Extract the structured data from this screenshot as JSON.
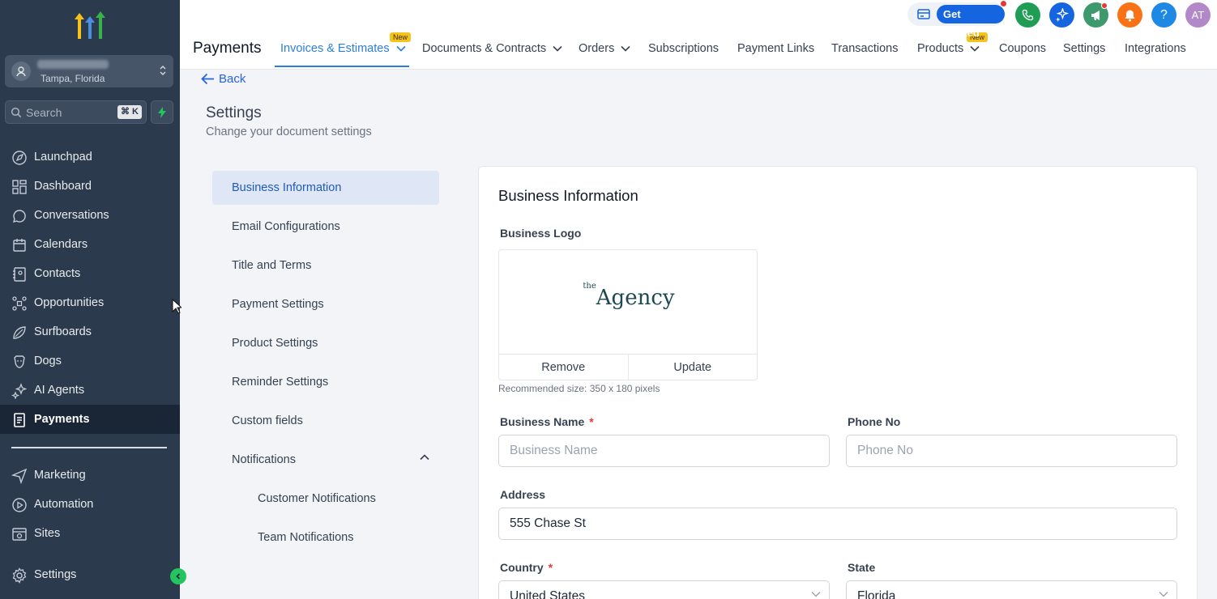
{
  "sidebar": {
    "account_location": "Tampa, Florida",
    "search_placeholder": "Search",
    "search_shortcut": "⌘ K",
    "items": [
      {
        "label": "Launchpad",
        "icon": "launchpad-icon"
      },
      {
        "label": "Dashboard",
        "icon": "dashboard-icon"
      },
      {
        "label": "Conversations",
        "icon": "chat-icon"
      },
      {
        "label": "Calendars",
        "icon": "calendar-icon"
      },
      {
        "label": "Contacts",
        "icon": "contacts-icon"
      },
      {
        "label": "Opportunities",
        "icon": "opportunities-icon"
      },
      {
        "label": "Surfboards",
        "icon": "surfboard-icon"
      },
      {
        "label": "Dogs",
        "icon": "dog-icon"
      },
      {
        "label": "AI Agents",
        "icon": "sparkle-icon"
      },
      {
        "label": "Payments",
        "icon": "payments-icon",
        "active": true
      }
    ],
    "lower_items": [
      {
        "label": "Marketing",
        "icon": "send-icon"
      },
      {
        "label": "Automation",
        "icon": "automation-icon"
      },
      {
        "label": "Sites",
        "icon": "sites-icon"
      }
    ],
    "settings_label": "Settings"
  },
  "header": {
    "title": "Payments",
    "tabs": [
      {
        "label": "Invoices & Estimates",
        "active": true,
        "dropdown": true,
        "badge": "New"
      },
      {
        "label": "Documents & Contracts",
        "dropdown": true
      },
      {
        "label": "Orders",
        "dropdown": true
      },
      {
        "label": "Subscriptions"
      },
      {
        "label": "Payment Links"
      },
      {
        "label": "Transactions"
      },
      {
        "label": "Products",
        "dropdown": true,
        "badge": "New"
      },
      {
        "label": "Coupons"
      },
      {
        "label": "Settings"
      },
      {
        "label": "Integrations"
      }
    ],
    "get_started": "Get Started",
    "help": "?",
    "avatar_initials": "AT",
    "colors": {
      "phone": "#1f9d55",
      "ai": "#1565e0",
      "megaphone": "#3d9a6d",
      "bell": "#f97316",
      "help": "#1e88e5",
      "avatar": "#b388c9"
    }
  },
  "page": {
    "back_label": "Back",
    "title": "Settings",
    "subtitle": "Change your document settings",
    "settings_nav": [
      {
        "label": "Business Information",
        "active": true
      },
      {
        "label": "Email Configurations"
      },
      {
        "label": "Title and Terms"
      },
      {
        "label": "Payment Settings"
      },
      {
        "label": "Product Settings"
      },
      {
        "label": "Reminder Settings"
      },
      {
        "label": "Custom fields"
      },
      {
        "label": "Notifications",
        "expanded": true
      },
      {
        "label": "Customer Notifications",
        "sub": true
      },
      {
        "label": "Team Notifications",
        "sub": true
      }
    ]
  },
  "form": {
    "title": "Business Information",
    "logo_label": "Business Logo",
    "logo_text_prefix": "the",
    "logo_text": "Agency",
    "remove_label": "Remove",
    "update_label": "Update",
    "logo_hint": "Recommended size: 350 x 180 pixels",
    "business_name_label": "Business Name",
    "business_name_placeholder": "Business Name",
    "phone_label": "Phone No",
    "phone_placeholder": "Phone No",
    "address_label": "Address",
    "address_value": "555 Chase St",
    "country_label": "Country",
    "country_value": "United States",
    "state_label": "State",
    "state_value": "Florida",
    "required_mark": "*"
  }
}
